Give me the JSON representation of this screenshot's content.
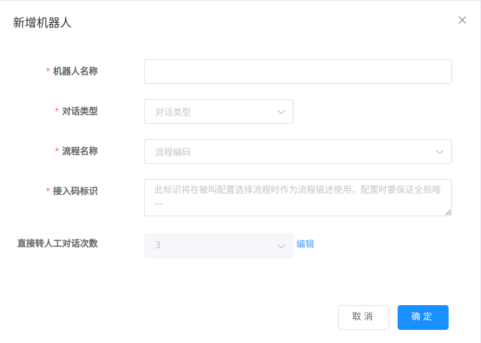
{
  "dialog": {
    "title": "新增机器人",
    "close_icon": "close-icon"
  },
  "form": {
    "robot_name": {
      "required_mark": "*",
      "label": "机器人名称",
      "value": ""
    },
    "dialog_type": {
      "required_mark": "*",
      "label": "对话类型",
      "placeholder": "对话类型",
      "icon": "chevron-down-icon"
    },
    "flow_name": {
      "required_mark": "*",
      "label": "流程名称",
      "placeholder": "流程编码",
      "icon": "chevron-down-icon"
    },
    "access_code": {
      "required_mark": "*",
      "label": "接入码标识",
      "placeholder": "此标识将在被叫配置选择流程时作为流程描述使用，配置时要保证全局唯一"
    },
    "transfer_count": {
      "label": "直接转人工对话次数",
      "value": "3",
      "edit_label": "编辑",
      "icon": "chevron-down-icon"
    }
  },
  "footer": {
    "cancel_label": "取消",
    "ok_label": "确定"
  },
  "colors": {
    "primary": "#1890ff",
    "required": "#f56c6c",
    "link": "#409eff"
  }
}
